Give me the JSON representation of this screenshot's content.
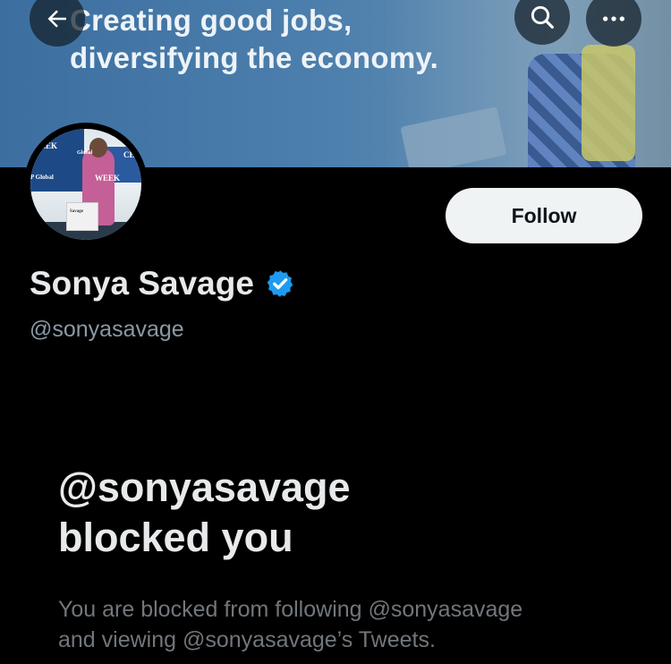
{
  "banner": {
    "line1": "Creating good jobs,",
    "line2": "diversifying the economy."
  },
  "nav": {
    "back_icon": "arrow-left-icon",
    "search_icon": "search-icon",
    "more_icon": "more-horizontal-icon"
  },
  "avatar": {
    "labels": [
      "WEEK",
      "Global",
      "CE",
      "P Global",
      "WEEK",
      "Savage"
    ]
  },
  "profile": {
    "name": "Sonya Savage",
    "handle": "@sonyasavage",
    "verified_icon": "verified-badge-icon",
    "verified_color": "#1d9bf0"
  },
  "actions": {
    "follow_label": "Follow"
  },
  "blocked": {
    "title_line1": "@sonyasavage",
    "title_line2": "blocked you",
    "desc_line1": "You are blocked from following @sonyasavage",
    "desc_line2": "and viewing @sonyasavage’s Tweets."
  }
}
